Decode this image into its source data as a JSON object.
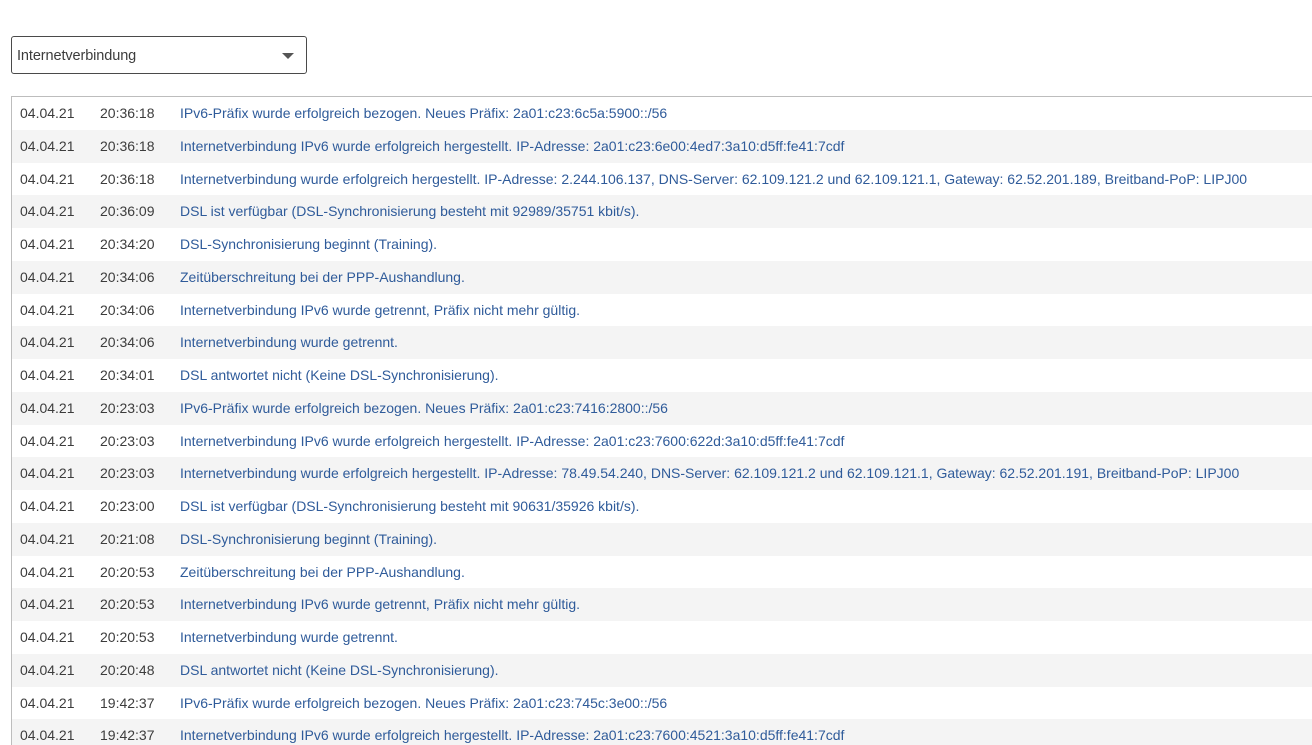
{
  "filter": {
    "selected": "Internetverbindung"
  },
  "log": [
    {
      "date": "04.04.21",
      "time": "20:36:18",
      "message": "IPv6-Präfix wurde erfolgreich bezogen. Neues Präfix: 2a01:c23:6c5a:5900::/56"
    },
    {
      "date": "04.04.21",
      "time": "20:36:18",
      "message": "Internetverbindung IPv6 wurde erfolgreich hergestellt. IP-Adresse: 2a01:c23:6e00:4ed7:3a10:d5ff:fe41:7cdf"
    },
    {
      "date": "04.04.21",
      "time": "20:36:18",
      "message": "Internetverbindung wurde erfolgreich hergestellt. IP-Adresse: 2.244.106.137, DNS-Server: 62.109.121.2 und 62.109.121.1, Gateway: 62.52.201.189, Breitband-PoP: LIPJ00"
    },
    {
      "date": "04.04.21",
      "time": "20:36:09",
      "message": "DSL ist verfügbar (DSL-Synchronisierung besteht mit 92989/35751 kbit/s)."
    },
    {
      "date": "04.04.21",
      "time": "20:34:20",
      "message": "DSL-Synchronisierung beginnt (Training)."
    },
    {
      "date": "04.04.21",
      "time": "20:34:06",
      "message": "Zeitüberschreitung bei der PPP-Aushandlung."
    },
    {
      "date": "04.04.21",
      "time": "20:34:06",
      "message": "Internetverbindung IPv6 wurde getrennt, Präfix nicht mehr gültig."
    },
    {
      "date": "04.04.21",
      "time": "20:34:06",
      "message": "Internetverbindung wurde getrennt."
    },
    {
      "date": "04.04.21",
      "time": "20:34:01",
      "message": "DSL antwortet nicht (Keine DSL-Synchronisierung)."
    },
    {
      "date": "04.04.21",
      "time": "20:23:03",
      "message": "IPv6-Präfix wurde erfolgreich bezogen. Neues Präfix: 2a01:c23:7416:2800::/56"
    },
    {
      "date": "04.04.21",
      "time": "20:23:03",
      "message": "Internetverbindung IPv6 wurde erfolgreich hergestellt. IP-Adresse: 2a01:c23:7600:622d:3a10:d5ff:fe41:7cdf"
    },
    {
      "date": "04.04.21",
      "time": "20:23:03",
      "message": "Internetverbindung wurde erfolgreich hergestellt. IP-Adresse: 78.49.54.240, DNS-Server: 62.109.121.2 und 62.109.121.1, Gateway: 62.52.201.191, Breitband-PoP: LIPJ00"
    },
    {
      "date": "04.04.21",
      "time": "20:23:00",
      "message": "DSL ist verfügbar (DSL-Synchronisierung besteht mit 90631/35926 kbit/s)."
    },
    {
      "date": "04.04.21",
      "time": "20:21:08",
      "message": "DSL-Synchronisierung beginnt (Training)."
    },
    {
      "date": "04.04.21",
      "time": "20:20:53",
      "message": "Zeitüberschreitung bei der PPP-Aushandlung."
    },
    {
      "date": "04.04.21",
      "time": "20:20:53",
      "message": "Internetverbindung IPv6 wurde getrennt, Präfix nicht mehr gültig."
    },
    {
      "date": "04.04.21",
      "time": "20:20:53",
      "message": "Internetverbindung wurde getrennt."
    },
    {
      "date": "04.04.21",
      "time": "20:20:48",
      "message": "DSL antwortet nicht (Keine DSL-Synchronisierung)."
    },
    {
      "date": "04.04.21",
      "time": "19:42:37",
      "message": "IPv6-Präfix wurde erfolgreich bezogen. Neues Präfix: 2a01:c23:745c:3e00::/56"
    },
    {
      "date": "04.04.21",
      "time": "19:42:37",
      "message": "Internetverbindung IPv6 wurde erfolgreich hergestellt. IP-Adresse: 2a01:c23:7600:4521:3a10:d5ff:fe41:7cdf"
    }
  ]
}
